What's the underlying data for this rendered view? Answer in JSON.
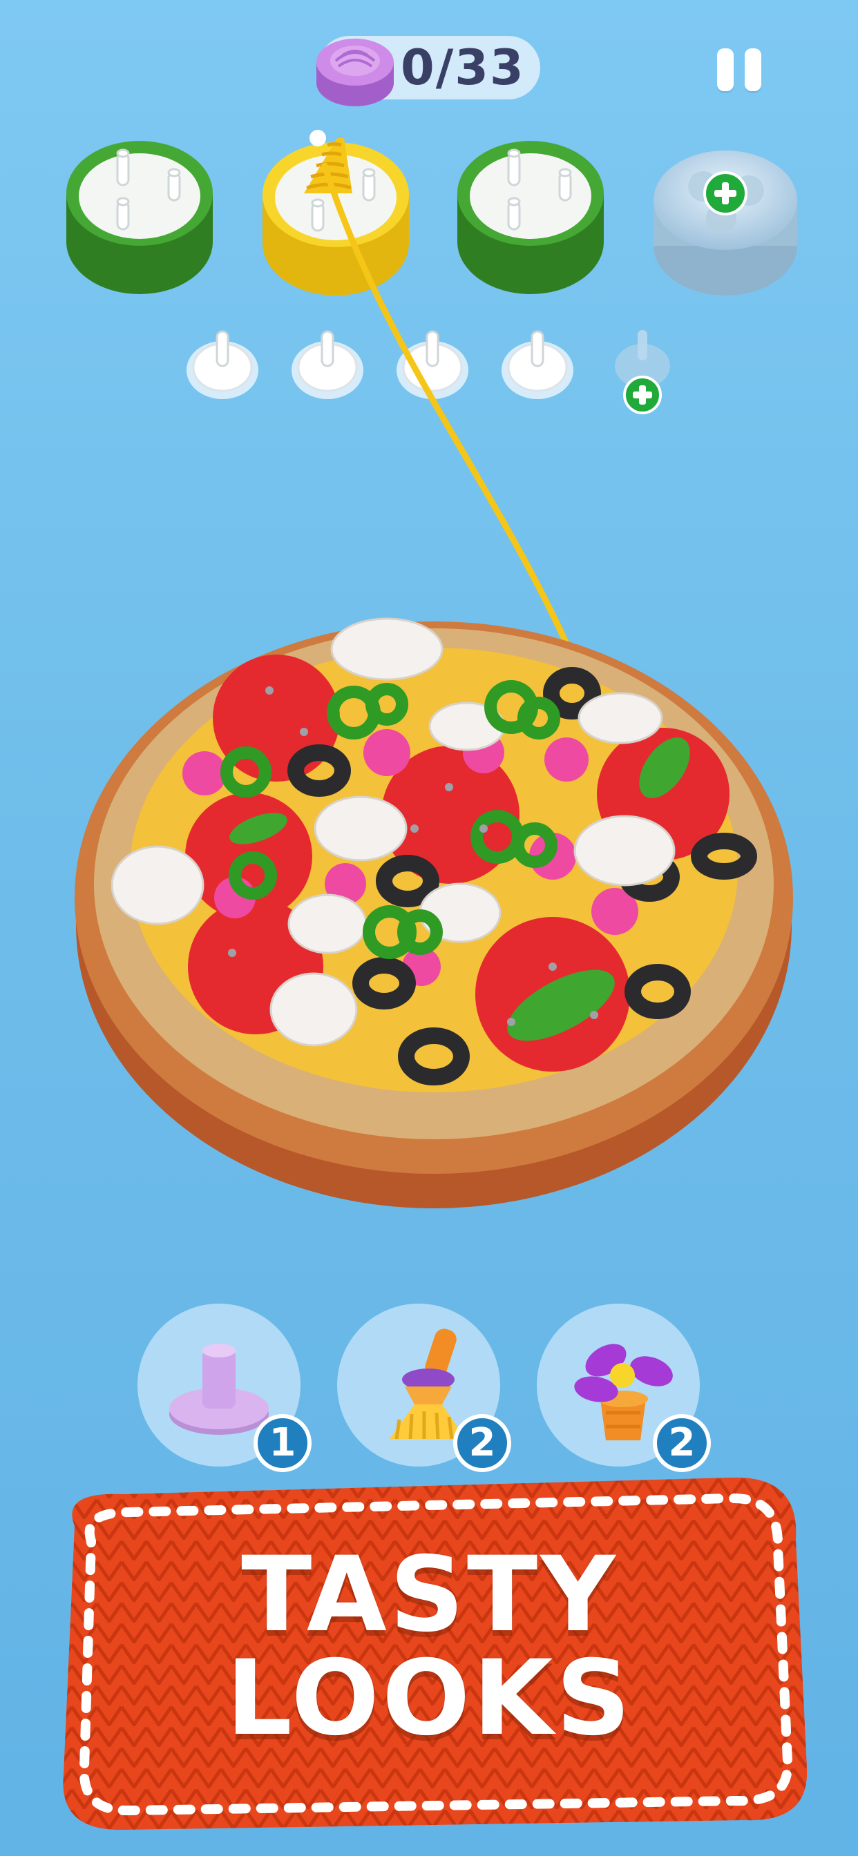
{
  "hud": {
    "progress_label": "0/33",
    "icons": {
      "progress": "yarn-ball-icon",
      "pause": "pause-icon"
    }
  },
  "spools": [
    {
      "id": "spool-1",
      "color": "#3a9a2c",
      "state": "empty"
    },
    {
      "id": "spool-2",
      "color": "#f3cf22",
      "state": "active"
    },
    {
      "id": "spool-3",
      "color": "#3a9a2c",
      "state": "empty"
    },
    {
      "id": "spool-4",
      "color": "#b9d7ea",
      "state": "locked",
      "icon": "plus-icon"
    }
  ],
  "pegs": [
    {
      "id": "peg-1",
      "state": "empty"
    },
    {
      "id": "peg-2",
      "state": "empty"
    },
    {
      "id": "peg-3",
      "state": "empty"
    },
    {
      "id": "peg-4",
      "state": "empty"
    },
    {
      "id": "peg-5",
      "state": "locked",
      "icon": "plus-icon"
    }
  ],
  "powerups": [
    {
      "name": "peg",
      "icon": "peg-icon",
      "count": "1"
    },
    {
      "name": "brush",
      "icon": "brush-icon",
      "count": "2"
    },
    {
      "name": "spinner",
      "icon": "spinner-icon",
      "count": "2"
    }
  ],
  "banner": {
    "line1": "TASTY",
    "line2": "LOOKS",
    "color": "#e84a1e"
  },
  "colors": {
    "background": "#6fbdea",
    "yarn_yellow": "#f5c518",
    "badge_blue": "#1f7fbf"
  }
}
